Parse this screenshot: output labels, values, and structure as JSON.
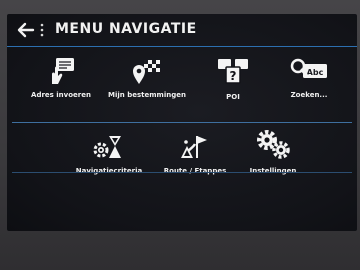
{
  "header": {
    "title": "MENU NAVIGATIE",
    "back_icon": "back-arrow-icon",
    "more_icon": "vertical-dots-icon"
  },
  "menu": [
    {
      "label": "Adres invoeren",
      "icon": "hand-enter-address-icon"
    },
    {
      "label": "Mijn bestemmingen",
      "icon": "pin-checkered-flag-icon"
    },
    {
      "label": "POI",
      "icon": "poi-question-icon"
    },
    {
      "label": "Zoeken...",
      "icon": "search-abc-icon"
    },
    {
      "label": "Navigatiecriteria",
      "icon": "criteria-hourglass-icon"
    },
    {
      "label": "Route / Etappes",
      "icon": "route-flags-icon"
    },
    {
      "label": "Instellingen",
      "icon": "gears-icon"
    }
  ],
  "colors": {
    "accent_line": "#2c6fb0",
    "background": "#121318",
    "text": "#f0f0f0"
  }
}
